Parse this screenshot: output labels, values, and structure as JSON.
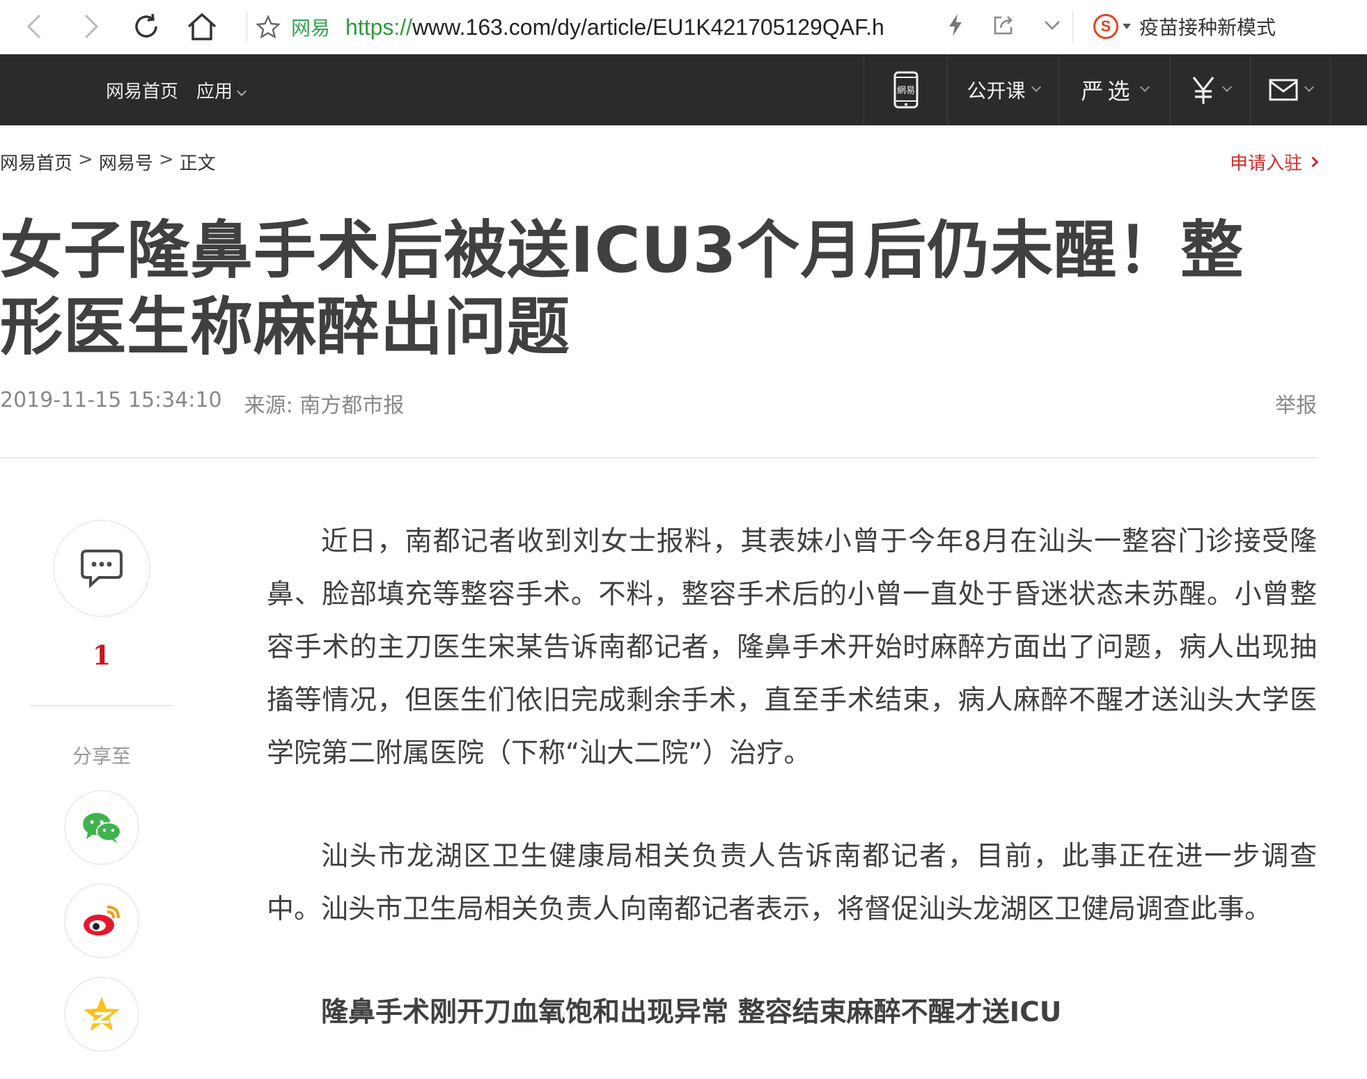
{
  "browser": {
    "site_label": "网易",
    "url_scheme": "https://",
    "url_rest": "www.163.com/dy/article/EU1K421705129QAF.h",
    "search_engine_icon": "sogou-icon",
    "search_hint": "疫苗接种新模式"
  },
  "site_nav": {
    "home": "网易首页",
    "apps": "应用",
    "open_course": "公开课",
    "yanxuan": "严选",
    "phone_label": "網易"
  },
  "breadcrumb": {
    "home": "网易首页",
    "sep": ">",
    "channel": "网易号",
    "current": "正文"
  },
  "apply_link": "申请入驻",
  "article": {
    "title": "女子隆鼻手术后被送ICU3个月后仍未醒！整形医生称麻醉出问题",
    "datetime": "2019-11-15 15:34:10",
    "source": "来源: 南方都市报",
    "report": "举报",
    "paragraphs": [
      "近日，南都记者收到刘女士报料，其表妹小曾于今年8月在汕头一整容门诊接受隆鼻、脸部填充等整容手术。不料，整容手术后的小曾一直处于昏迷状态未苏醒。小曾整容手术的主刀医生宋某告诉南都记者，隆鼻手术开始时麻醉方面出了问题，病人出现抽搐等情况，但医生们依旧完成剩余手术，直至手术结束，病人麻醉不醒才送汕头大学医学院第二附属医院（下称“汕大二院”）治疗。",
      "汕头市龙湖区卫生健康局相关负责人告诉南都记者，目前，此事正在进一步调查中。汕头市卫生局相关负责人向南都记者表示，将督促汕头龙湖区卫健局调查此事。"
    ],
    "subheading": "隆鼻手术刚开刀血氧饱和出现异常 整容结束麻醉不醒才送ICU"
  },
  "share": {
    "comment_count": "1",
    "label": "分享至",
    "targets": [
      "wechat-icon",
      "weibo-icon",
      "qzone-icon"
    ]
  },
  "colors": {
    "nav_bg": "#2b2b2b",
    "accent_red": "#d22b2b",
    "url_green": "#2e9a3c"
  }
}
